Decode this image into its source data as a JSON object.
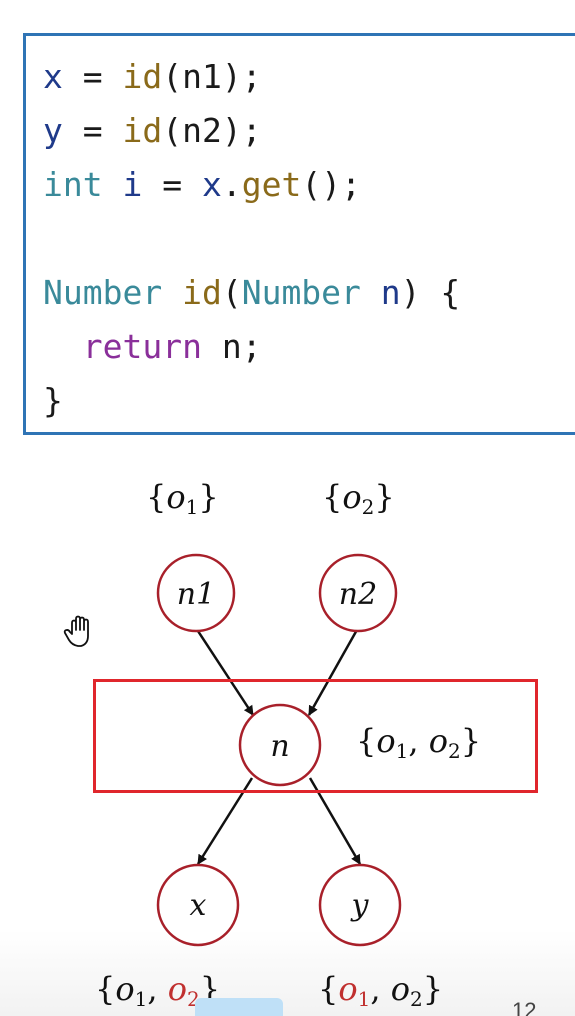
{
  "code": {
    "line1": {
      "var": "x",
      "eq": " = ",
      "fn": "id",
      "args": "(n1);"
    },
    "line2": {
      "var": "y",
      "eq": " = ",
      "fn": "id",
      "args": "(n2);"
    },
    "line3": {
      "type": "int",
      "var": " i",
      "eq": " = ",
      "obj": "x",
      "dot": ".",
      "fn": "get",
      "args": "();"
    },
    "line5": {
      "type": "Number",
      "fn": " id",
      "open": "(",
      "ptype": "Number",
      "pname": " n",
      "close": ") {"
    },
    "line6": {
      "indent": "  ",
      "kw": "return",
      "rest": " n;"
    },
    "line7": {
      "brace": "}"
    }
  },
  "graph": {
    "nodes": {
      "n1": {
        "label": "n1",
        "set": {
          "open": "{",
          "o": "o",
          "sub": "1",
          "close": "}"
        }
      },
      "n2": {
        "label": "n2",
        "set": {
          "open": "{",
          "o": "o",
          "sub": "2",
          "close": "}"
        }
      },
      "n": {
        "label": "n",
        "set": {
          "open": "{",
          "o1": "o",
          "sub1": "1",
          "comma": ", ",
          "o2": "o",
          "sub2": "2",
          "close": "}"
        }
      },
      "x": {
        "label": "x",
        "set": {
          "open": "{",
          "o1": "o",
          "sub1": "1",
          "comma": ", ",
          "o2": "o",
          "sub2": "2",
          "close": "}"
        }
      },
      "y": {
        "label": "y",
        "set": {
          "open": "{",
          "o1": "o",
          "sub1": "1",
          "comma": ", ",
          "o2": "o",
          "sub2": "2",
          "close": "}"
        }
      }
    },
    "edges": [
      [
        "n1",
        "n"
      ],
      [
        "n2",
        "n"
      ],
      [
        "n",
        "x"
      ],
      [
        "n",
        "y"
      ]
    ],
    "colors": {
      "node_stroke": "#a8202a",
      "edge": "#111111",
      "highlight": "#e0262c",
      "code_border": "#2f74b5",
      "new_object": "#c0302f"
    }
  },
  "footer": {
    "page_number": "12"
  },
  "icons": {
    "cursor": "hand-cursor-icon"
  }
}
